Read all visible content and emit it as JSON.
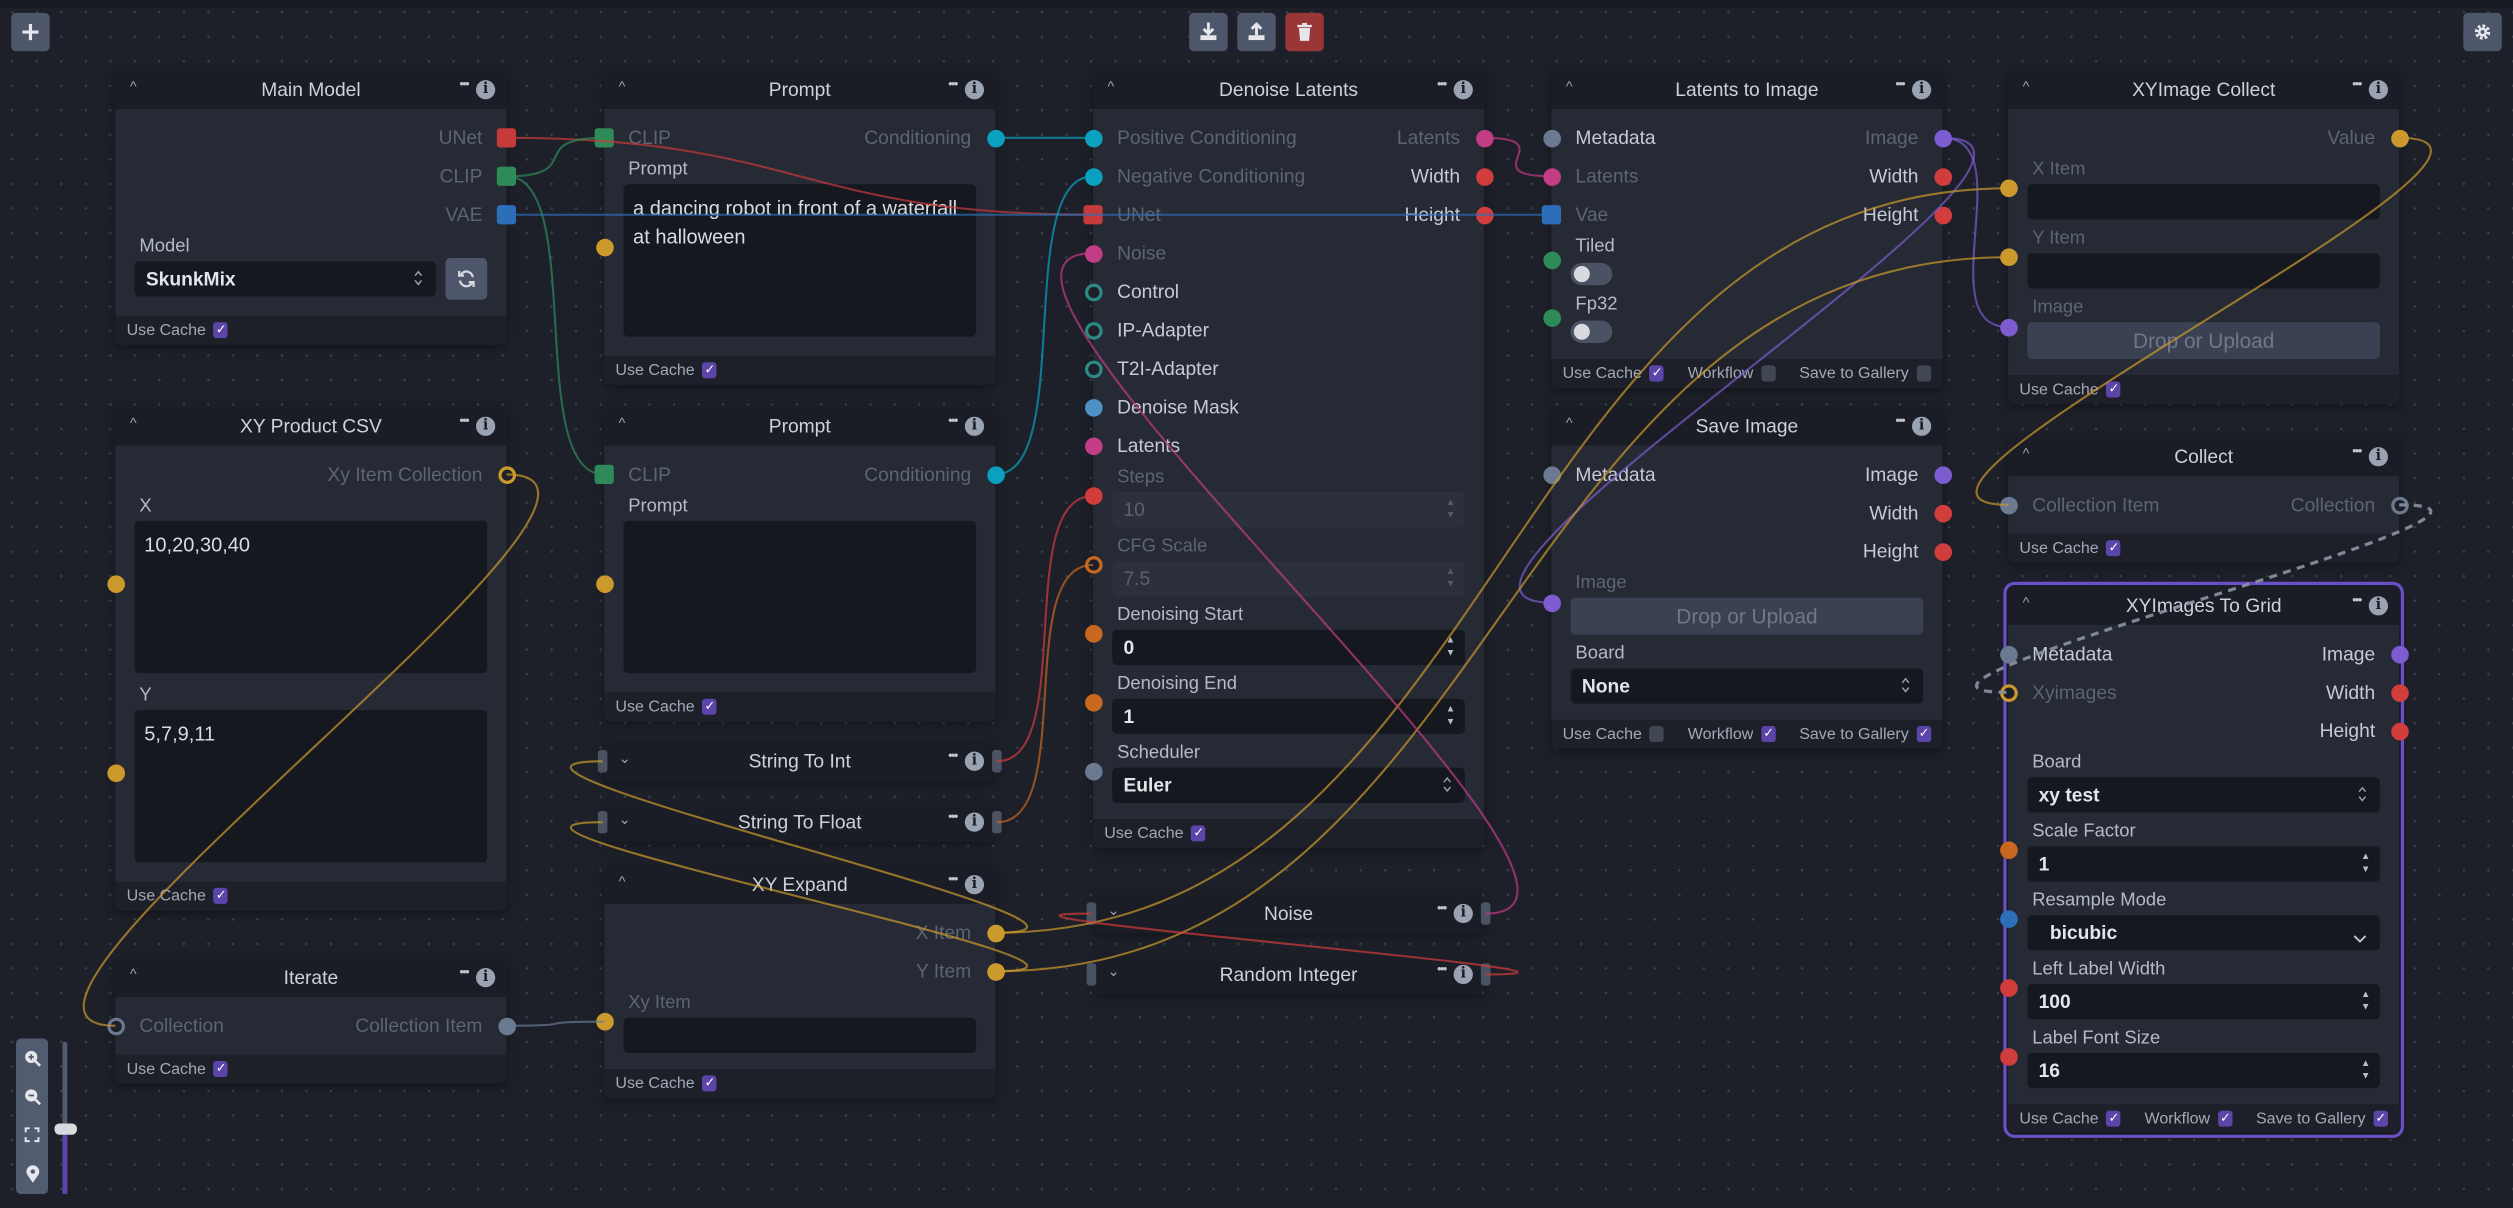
{
  "toolbar": {
    "left": [
      "add-node"
    ],
    "center": [
      "download-workflow",
      "upload-workflow",
      "clear-workflow"
    ],
    "right": [
      "settings"
    ]
  },
  "zoom_controls": {
    "items": [
      "zoom-in",
      "zoom-out",
      "fit-view",
      "minimap"
    ],
    "zoom_level_fraction": 0.42
  },
  "colors": {
    "unet": "#c53a3a",
    "clip": "#2f8a5a",
    "vae": "#2c6fb8",
    "conditioning": "#0aa1c0",
    "latents": "#c33c86",
    "integer": "#d13c3c",
    "float": "#c8681f",
    "image": "#7d5bd0",
    "metadata": "#6b7a90",
    "string": "#cc9a2c",
    "boolean": "#2f8a5a",
    "control": "#2c8a84",
    "mask": "#4f90c6",
    "enum": "#2c6fb8",
    "accent": "#5b45a8",
    "danger": "#9a3636"
  },
  "nodes": [
    {
      "id": "main_model",
      "title": "Main Model",
      "items": [
        {
          "kind": "port",
          "out": {
            "label": "UNet",
            "type": "unet",
            "shape": "square",
            "connected": true
          }
        },
        {
          "kind": "port",
          "out": {
            "label": "CLIP",
            "type": "clip",
            "shape": "square",
            "connected": true
          }
        },
        {
          "kind": "port",
          "out": {
            "label": "VAE",
            "type": "vae",
            "shape": "square",
            "connected": true
          }
        },
        {
          "kind": "select",
          "label": "Model",
          "value": "SkunkMix",
          "refresh": true
        }
      ],
      "footer": [
        {
          "label": "Use Cache",
          "checked": true
        }
      ]
    },
    {
      "id": "prompt1",
      "title": "Prompt",
      "items": [
        {
          "kind": "port",
          "in": {
            "label": "CLIP",
            "type": "clip",
            "shape": "square",
            "connected": true
          },
          "out": {
            "label": "Conditioning",
            "type": "conditioning",
            "shape": "circle",
            "connected": true
          }
        },
        {
          "kind": "textarea",
          "label": "Prompt",
          "value": "a dancing robot in front of a waterfall at halloween",
          "handle": {
            "type": "string",
            "shape": "circle"
          }
        }
      ],
      "footer": [
        {
          "label": "Use Cache",
          "checked": true
        }
      ]
    },
    {
      "id": "xy_csv",
      "title": "XY Product CSV",
      "items": [
        {
          "kind": "port",
          "out": {
            "label": "Xy Item Collection",
            "type": "string",
            "shape": "ring",
            "connected": true
          }
        },
        {
          "kind": "textarea",
          "label": "X",
          "value": "10,20,30,40",
          "handle": {
            "type": "string",
            "shape": "circle"
          }
        },
        {
          "kind": "textarea",
          "label": "Y",
          "value": "5,7,9,11",
          "handle": {
            "type": "string",
            "shape": "circle"
          }
        }
      ],
      "footer": [
        {
          "label": "Use Cache",
          "checked": true
        }
      ]
    },
    {
      "id": "prompt2",
      "title": "Prompt",
      "items": [
        {
          "kind": "port",
          "in": {
            "label": "CLIP",
            "type": "clip",
            "shape": "square",
            "connected": true
          },
          "out": {
            "label": "Conditioning",
            "type": "conditioning",
            "shape": "circle",
            "connected": true
          }
        },
        {
          "kind": "textarea",
          "label": "Prompt",
          "value": "",
          "handle": {
            "type": "string",
            "shape": "circle"
          }
        }
      ],
      "footer": [
        {
          "label": "Use Cache",
          "checked": true
        }
      ]
    },
    {
      "id": "string_to_int",
      "title": "String To Int",
      "collapsed": true
    },
    {
      "id": "string_to_float",
      "title": "String To Float",
      "collapsed": true
    },
    {
      "id": "xy_expand",
      "title": "XY Expand",
      "items": [
        {
          "kind": "port",
          "out": {
            "label": "X Item",
            "type": "string",
            "shape": "circle",
            "connected": true
          }
        },
        {
          "kind": "port",
          "out": {
            "label": "Y Item",
            "type": "string",
            "shape": "circle",
            "connected": true
          }
        },
        {
          "kind": "text",
          "label": "Xy Item",
          "value": "",
          "connected": true,
          "handle": {
            "type": "string",
            "shape": "circle"
          }
        }
      ],
      "footer": [
        {
          "label": "Use Cache",
          "checked": true
        }
      ]
    },
    {
      "id": "iterate",
      "title": "Iterate",
      "items": [
        {
          "kind": "port",
          "in": {
            "label": "Collection",
            "type": "metadata",
            "shape": "ring",
            "connected": true
          },
          "out": {
            "label": "Collection Item",
            "type": "metadata",
            "shape": "circle",
            "connected": true
          }
        }
      ],
      "footer": [
        {
          "label": "Use Cache",
          "checked": true
        }
      ]
    },
    {
      "id": "denoise",
      "title": "Denoise Latents",
      "items": [
        {
          "kind": "port",
          "in": {
            "label": "Positive Conditioning",
            "type": "conditioning",
            "shape": "circle",
            "connected": true
          },
          "out": {
            "label": "Latents",
            "type": "latents",
            "shape": "circle",
            "connected": true
          }
        },
        {
          "kind": "port",
          "in": {
            "label": "Negative Conditioning",
            "type": "conditioning",
            "shape": "circle",
            "connected": true
          },
          "out": {
            "label": "Width",
            "type": "integer",
            "shape": "circle",
            "connected": false
          }
        },
        {
          "kind": "port",
          "in": {
            "label": "UNet",
            "type": "unet",
            "shape": "square",
            "connected": true
          },
          "out": {
            "label": "Height",
            "type": "integer",
            "shape": "circle",
            "connected": false
          }
        },
        {
          "kind": "port",
          "in": {
            "label": "Noise",
            "type": "latents",
            "shape": "circle",
            "connected": true
          }
        },
        {
          "kind": "port",
          "in": {
            "label": "Control",
            "type": "control",
            "shape": "ring",
            "connected": false
          }
        },
        {
          "kind": "port",
          "in": {
            "label": "IP-Adapter",
            "type": "control",
            "shape": "ring",
            "connected": false
          }
        },
        {
          "kind": "port",
          "in": {
            "label": "T2I-Adapter",
            "type": "control",
            "shape": "ring",
            "connected": false
          }
        },
        {
          "kind": "port",
          "in": {
            "label": "Denoise Mask",
            "type": "mask",
            "shape": "circle",
            "connected": false
          }
        },
        {
          "kind": "port",
          "in": {
            "label": "Latents",
            "type": "latents",
            "shape": "circle",
            "connected": false
          }
        },
        {
          "kind": "number",
          "label": "Steps",
          "value": "10",
          "connected": true,
          "handle": {
            "type": "integer",
            "shape": "circle"
          }
        },
        {
          "kind": "number",
          "label": "CFG Scale",
          "value": "7.5",
          "connected": true,
          "handle": {
            "type": "float",
            "shape": "ring"
          }
        },
        {
          "kind": "number",
          "label": "Denoising Start",
          "value": "0",
          "handle": {
            "type": "float",
            "shape": "circle"
          }
        },
        {
          "kind": "number",
          "label": "Denoising End",
          "value": "1",
          "handle": {
            "type": "float",
            "shape": "circle"
          }
        },
        {
          "kind": "select",
          "label": "Scheduler",
          "value": "Euler",
          "handle": {
            "type": "metadata",
            "shape": "circle"
          }
        }
      ],
      "footer": [
        {
          "label": "Use Cache",
          "checked": true
        }
      ]
    },
    {
      "id": "noise",
      "title": "Noise",
      "collapsed": true
    },
    {
      "id": "random_integer",
      "title": "Random Integer",
      "collapsed": true
    },
    {
      "id": "l2i",
      "title": "Latents to Image",
      "items": [
        {
          "kind": "port",
          "in": {
            "label": "Metadata",
            "type": "metadata",
            "shape": "circle",
            "connected": false
          },
          "out": {
            "label": "Image",
            "type": "image",
            "shape": "circle",
            "connected": true
          }
        },
        {
          "kind": "port",
          "in": {
            "label": "Latents",
            "type": "latents",
            "shape": "circle",
            "connected": true
          },
          "out": {
            "label": "Width",
            "type": "integer",
            "shape": "circle",
            "connected": false
          }
        },
        {
          "kind": "port",
          "in": {
            "label": "Vae",
            "type": "vae",
            "shape": "square",
            "connected": true
          },
          "out": {
            "label": "Height",
            "type": "integer",
            "shape": "circle",
            "connected": false
          }
        },
        {
          "kind": "toggle",
          "label": "Tiled",
          "value": false,
          "handle": {
            "type": "boolean",
            "shape": "circle"
          }
        },
        {
          "kind": "toggle",
          "label": "Fp32",
          "value": false,
          "handle": {
            "type": "boolean",
            "shape": "circle"
          }
        }
      ],
      "footer": [
        {
          "label": "Use Cache",
          "checked": true
        },
        {
          "label": "Workflow",
          "checked": false
        },
        {
          "label": "Save to Gallery",
          "checked": false
        }
      ]
    },
    {
      "id": "save_image",
      "title": "Save Image",
      "items": [
        {
          "kind": "port",
          "in": {
            "label": "Metadata",
            "type": "metadata",
            "shape": "circle",
            "connected": false
          },
          "out": {
            "label": "Image",
            "type": "image",
            "shape": "circle",
            "connected": false
          }
        },
        {
          "kind": "port",
          "out": {
            "label": "Width",
            "type": "integer",
            "shape": "circle",
            "connected": false
          }
        },
        {
          "kind": "port",
          "out": {
            "label": "Height",
            "type": "integer",
            "shape": "circle",
            "connected": false
          }
        },
        {
          "kind": "upload",
          "label": "Image",
          "value": "Drop or Upload",
          "connected": true,
          "handle": {
            "type": "image",
            "shape": "circle"
          }
        },
        {
          "kind": "select",
          "label": "Board",
          "value": "None"
        }
      ],
      "footer": [
        {
          "label": "Use Cache",
          "checked": false
        },
        {
          "label": "Workflow",
          "checked": true
        },
        {
          "label": "Save to Gallery",
          "checked": true
        }
      ]
    },
    {
      "id": "xy_collect",
      "title": "XYImage Collect",
      "items": [
        {
          "kind": "port",
          "out": {
            "label": "Value",
            "type": "string",
            "shape": "circle",
            "connected": true
          }
        },
        {
          "kind": "text",
          "label": "X Item",
          "value": "",
          "connected": true,
          "handle": {
            "type": "string",
            "shape": "circle"
          }
        },
        {
          "kind": "text",
          "label": "Y Item",
          "value": "",
          "connected": true,
          "handle": {
            "type": "string",
            "shape": "circle"
          }
        },
        {
          "kind": "upload",
          "label": "Image",
          "value": "Drop or Upload",
          "connected": true,
          "handle": {
            "type": "image",
            "shape": "circle"
          }
        }
      ],
      "footer": [
        {
          "label": "Use Cache",
          "checked": true
        }
      ]
    },
    {
      "id": "collect",
      "title": "Collect",
      "items": [
        {
          "kind": "port",
          "in": {
            "label": "Collection Item",
            "type": "metadata",
            "shape": "circle",
            "connected": true
          },
          "out": {
            "label": "Collection",
            "type": "metadata",
            "shape": "ring",
            "connected": true
          }
        }
      ],
      "footer": [
        {
          "label": "Use Cache",
          "checked": true
        }
      ]
    },
    {
      "id": "xy_grid",
      "title": "XYImages To Grid",
      "selected": true,
      "items": [
        {
          "kind": "port",
          "in": {
            "label": "Metadata",
            "type": "metadata",
            "shape": "circle",
            "connected": false
          },
          "out": {
            "label": "Image",
            "type": "image",
            "shape": "circle",
            "connected": false
          }
        },
        {
          "kind": "port",
          "in": {
            "label": "Xyimages",
            "type": "string",
            "shape": "ring",
            "connected": true
          },
          "out": {
            "label": "Width",
            "type": "integer",
            "shape": "circle",
            "connected": false
          }
        },
        {
          "kind": "port",
          "out": {
            "label": "Height",
            "type": "integer",
            "shape": "circle",
            "connected": false
          }
        },
        {
          "kind": "select",
          "label": "Board",
          "value": "xy test"
        },
        {
          "kind": "number",
          "label": "Scale Factor",
          "value": "1",
          "handle": {
            "type": "float",
            "shape": "circle"
          }
        },
        {
          "kind": "dropdown",
          "label": "Resample Mode",
          "value": "bicubic",
          "handle": {
            "type": "enum",
            "shape": "circle"
          }
        },
        {
          "kind": "number",
          "label": "Left Label Width",
          "value": "100",
          "handle": {
            "type": "integer",
            "shape": "circle"
          }
        },
        {
          "kind": "number",
          "label": "Label Font Size",
          "value": "16",
          "handle": {
            "type": "integer",
            "shape": "circle"
          }
        }
      ],
      "footer": [
        {
          "label": "Use Cache",
          "checked": true
        },
        {
          "label": "Workflow",
          "checked": true
        },
        {
          "label": "Save to Gallery",
          "checked": true
        }
      ]
    }
  ],
  "edges": [
    {
      "from": "main_model|out|UNet",
      "to": "denoise|in|UNet",
      "type": "unet"
    },
    {
      "from": "main_model|out|CLIP",
      "to": "prompt1|in|CLIP",
      "type": "clip"
    },
    {
      "from": "main_model|out|CLIP",
      "to": "prompt2|in|CLIP",
      "type": "clip"
    },
    {
      "from": "main_model|out|VAE",
      "to": "l2i|in|Vae",
      "type": "vae"
    },
    {
      "from": "prompt1|out|Conditioning",
      "to": "denoise|in|Positive Conditioning",
      "type": "conditioning"
    },
    {
      "from": "prompt2|out|Conditioning",
      "to": "denoise|in|Negative Conditioning",
      "type": "conditioning"
    },
    {
      "from": "denoise|out|Latents",
      "to": "l2i|in|Latents",
      "type": "latents"
    },
    {
      "from": "l2i|out|Image",
      "to": "xy_collect|in|Image",
      "type": "image"
    },
    {
      "from": "l2i|out|Image",
      "to": "save_image|in|Image",
      "type": "image"
    },
    {
      "from": "xy_expand|out|X Item",
      "to": "xy_collect|in|X Item",
      "type": "string"
    },
    {
      "from": "xy_expand|out|Y Item",
      "to": "xy_collect|in|Y Item",
      "type": "string"
    },
    {
      "from": "xy_expand|out|X Item",
      "to": "string_to_int|in|stub",
      "type": "string"
    },
    {
      "from": "xy_expand|out|Y Item",
      "to": "string_to_float|in|stub",
      "type": "string"
    },
    {
      "from": "string_to_int|out|stub",
      "to": "denoise|in|Steps",
      "type": "integer"
    },
    {
      "from": "string_to_float|out|stub",
      "to": "denoise|in|CFG Scale",
      "type": "float"
    },
    {
      "from": "xy_csv|out|Xy Item Collection",
      "to": "iterate|in|Collection",
      "type": "string"
    },
    {
      "from": "iterate|out|Collection Item",
      "to": "xy_expand|in|Xy Item",
      "type": "metadata"
    },
    {
      "from": "xy_collect|out|Value",
      "to": "collect|in|Collection Item",
      "type": "string"
    },
    {
      "from": "collect|out|Collection",
      "to": "xy_grid|in|Xyimages",
      "type": "metadata",
      "dashed": true
    },
    {
      "from": "noise|out|stub",
      "to": "denoise|in|Noise",
      "type": "latents"
    },
    {
      "from": "random_integer|out|stub",
      "to": "noise|in|stub",
      "type": "integer"
    }
  ]
}
